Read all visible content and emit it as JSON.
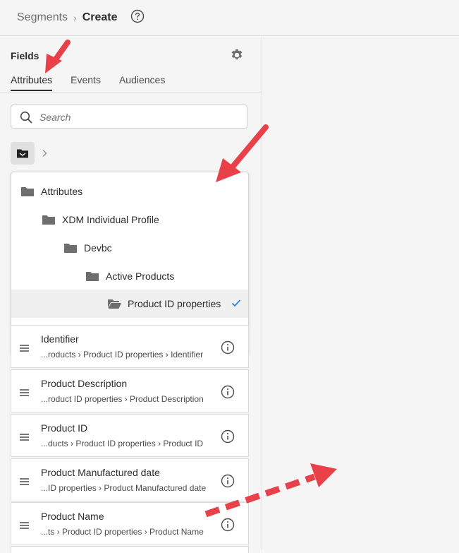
{
  "header": {
    "crumbs": [
      "Segments",
      "Create"
    ],
    "separator": "›"
  },
  "fields_panel": {
    "title": "Fields",
    "tabs": [
      {
        "label": "Attributes",
        "active": true
      },
      {
        "label": "Events",
        "active": false
      },
      {
        "label": "Audiences",
        "active": false
      }
    ],
    "search": {
      "placeholder": "Search",
      "value": ""
    }
  },
  "tree": {
    "items": [
      {
        "label": "Attributes",
        "depth": 0,
        "selected": false
      },
      {
        "label": "XDM Individual Profile",
        "depth": 1,
        "selected": false
      },
      {
        "label": "Devbc",
        "depth": 2,
        "selected": false
      },
      {
        "label": "Active Products",
        "depth": 3,
        "selected": false
      },
      {
        "label": "Product ID properties",
        "depth": 4,
        "selected": true
      }
    ]
  },
  "fields": [
    {
      "name": "Identifier",
      "path": "...roducts › Product ID properties › Identifier"
    },
    {
      "name": "Product Description",
      "path": "...roduct ID properties › Product Description"
    },
    {
      "name": "Product ID",
      "path": "...ducts › Product ID properties › Product ID"
    },
    {
      "name": "Product Manufactured date",
      "path": "...ID properties › Product Manufactured date"
    },
    {
      "name": "Product Name",
      "path": "...ts › Product ID properties › Product Name"
    }
  ],
  "colors": {
    "accent": "#2680eb",
    "annotation_arrow": "#e8414a",
    "icon_gray": "#6e6e6e"
  }
}
